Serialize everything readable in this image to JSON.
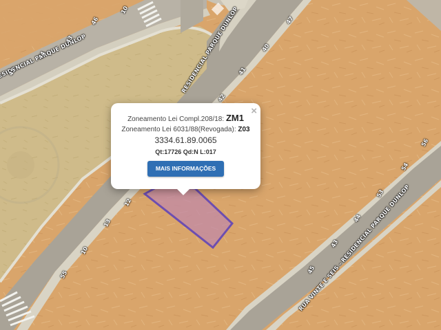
{
  "map": {
    "street_labels": {
      "upper_left": "RESIDENCIAL PARQUE DUNLOP",
      "upper_middle": "RESIDENCIAL PARQUE DUNLOP",
      "lower_right": "RUA VINTE E SEIS - RESIDENCIAL PARQUE DUNLOP"
    },
    "lot_numbers": [
      "10",
      "43",
      "44",
      "45",
      "46",
      "47",
      "40",
      "41",
      "42",
      "12",
      "13",
      "10",
      "55",
      "56",
      "54",
      "53",
      "44",
      "43",
      "45"
    ],
    "selected_lot_color": "#4a32c8",
    "selected_lot_fill": "#c28aa8"
  },
  "popup": {
    "zoneamento_compl_label": "Zoneamento Lei Compl.208/18:",
    "zoneamento_compl_value": "ZM1",
    "zoneamento_revogada_label": "Zoneamento Lei 6031/88(Revogada):",
    "zoneamento_revogada_value": "Z03",
    "inscricao": "3334.61.89.0065",
    "qt_qd_l": "Qt:17726 Qd:N L:017",
    "button_label": "MAIS INFORMAÇÕES",
    "close_label": "×",
    "button_color": "#2f6fb4"
  }
}
